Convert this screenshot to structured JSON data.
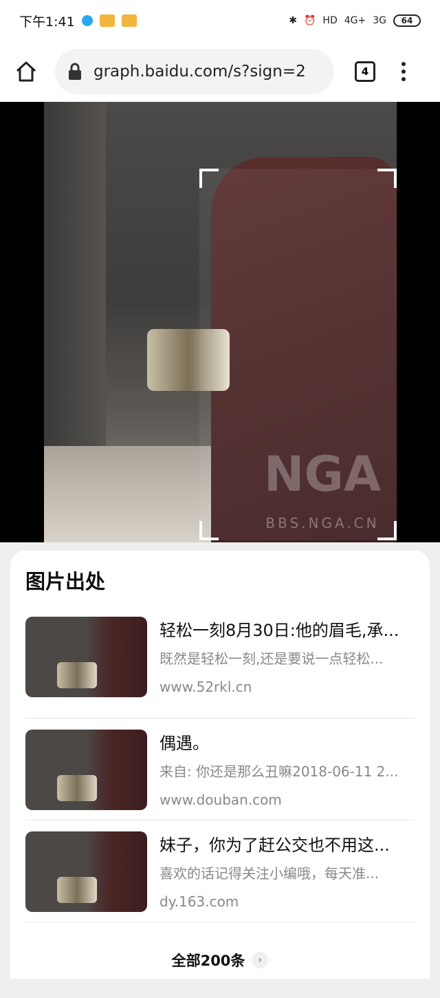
{
  "status": {
    "time": "下午1:41",
    "network_1": "4G+",
    "network_2": "3G",
    "hd": "HD",
    "battery": "64"
  },
  "browser": {
    "url": "graph.baidu.com/s?sign=2",
    "tab_count": "4"
  },
  "image": {
    "watermark_logo": "NGA",
    "watermark_text": "BBS.NGA.CN"
  },
  "sources": {
    "title": "图片出处",
    "items": [
      {
        "title": "轻松一刻8月30日:他的眉毛,承...",
        "desc": "既然是轻松一刻,还是要说一点轻松...",
        "site": "www.52rkl.cn"
      },
      {
        "title": "偶遇。",
        "desc": "来自: 你还是那么丑嘛2018-06-11 2...",
        "site": "www.douban.com"
      },
      {
        "title": "妹子，你为了赶公交也不用这...",
        "desc": "喜欢的话记得关注小编哦，每天准...",
        "site": "dy.163.com"
      }
    ],
    "see_all": "全部200条"
  }
}
